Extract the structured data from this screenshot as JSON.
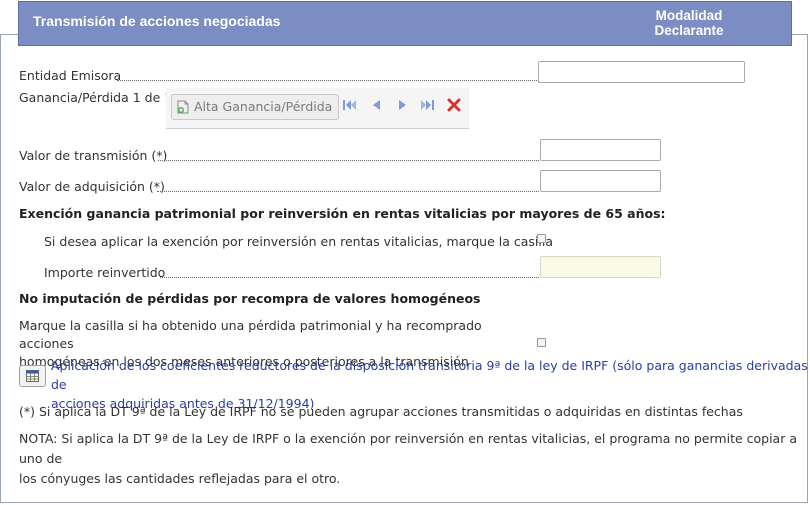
{
  "header": {
    "title": "Transmisión de acciones negociadas",
    "modalidad_line1": "Modalidad",
    "modalidad_line2": "Declarante"
  },
  "fields": {
    "entidad_emisora": {
      "label": "Entidad Emisora",
      "value": ""
    },
    "ganancia_perdida_counter": "Ganancia/Pérdida 1 de 1",
    "valor_transmision": {
      "label": "Valor de transmisión (*)",
      "value": ""
    },
    "valor_adquisicion": {
      "label": "Valor de adquisición (*)",
      "value": ""
    }
  },
  "toolbar": {
    "alta_label": "Alta Ganancia/Pérdida",
    "icons": [
      "first-icon",
      "prev-icon",
      "next-icon",
      "last-icon",
      "delete-icon"
    ]
  },
  "exencion": {
    "title": "Exención ganancia patrimonial por reinversión en rentas vitalicias por mayores de 65 años:",
    "checkbox_label": "Si desea aplicar la exención por reinversión en rentas vitalicias, marque la casilla",
    "checked": false,
    "importe_label": "Importe reinvertido",
    "importe_value": ""
  },
  "no_imputacion": {
    "title": "No imputación de pérdidas por recompra de valores homogéneos",
    "text_line1": "Marque la casilla si ha obtenido una pérdida patrimonial y ha recomprado acciones",
    "text_line2": "homogéneas en los dos meses anteriores o posteriores a la transmisión",
    "checked": false
  },
  "aplicacion_link": {
    "line1": "Aplicación de los coeficientes reductores de la disposición transitoria 9ª de la ley de IRPF (sólo para ganancias derivadas de",
    "line2": "acciones adquiridas antes de 31/12/1994)"
  },
  "notes": {
    "asterisk": "(*) Si aplica la DT 9ª de la Ley de IRPF no se pueden agrupar acciones transmitidas o adquiridas en distintas fechas",
    "nota_line1": "NOTA: Si aplica la DT 9ª de la Ley de IRPF o la exención por reinversión en rentas vitalicias, el programa no permite copiar a uno de",
    "nota_line2": "los cónyuges las cantidades reflejadas para el otro."
  },
  "colors": {
    "header_bg": "#7b8dc2",
    "link": "#2a3fa0",
    "nav_icon": "#7f9cd8",
    "delete_icon": "#d9342b"
  }
}
